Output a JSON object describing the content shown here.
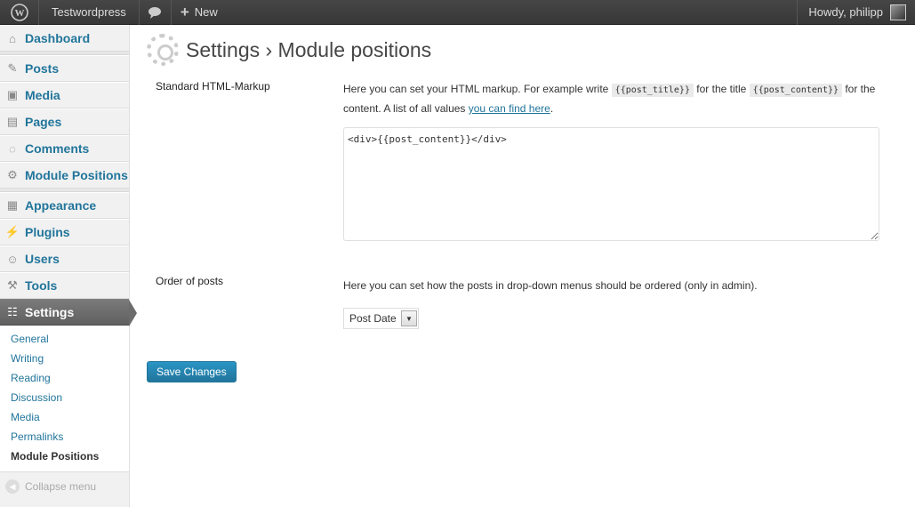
{
  "adminbar": {
    "site_name": "Testwordpress",
    "new_label": "New",
    "howdy": "Howdy, philipp",
    "icons": [
      "wordpress-logo-icon",
      "comment-icon",
      "plus-icon"
    ]
  },
  "sidebar": {
    "items": [
      {
        "label": "Dashboard",
        "icon": "home-icon"
      },
      {
        "label": "Posts",
        "icon": "pin-icon"
      },
      {
        "label": "Media",
        "icon": "media-icon"
      },
      {
        "label": "Pages",
        "icon": "pages-icon"
      },
      {
        "label": "Comments",
        "icon": "comment-icon"
      },
      {
        "label": "Module Positions",
        "icon": "gear-icon"
      },
      {
        "label": "Appearance",
        "icon": "appearance-icon"
      },
      {
        "label": "Plugins",
        "icon": "plugin-icon"
      },
      {
        "label": "Users",
        "icon": "users-icon"
      },
      {
        "label": "Tools",
        "icon": "tools-icon"
      },
      {
        "label": "Settings",
        "icon": "settings-icon"
      }
    ],
    "submenu": [
      "General",
      "Writing",
      "Reading",
      "Discussion",
      "Media",
      "Permalinks",
      "Module Positions"
    ],
    "collapse_label": "Collapse menu"
  },
  "page": {
    "title": "Settings › Module positions",
    "markup_label": "Standard HTML-Markup",
    "markup_desc_1": "Here you can set your HTML markup. For example write ",
    "code_title": "{{post_title}}",
    "markup_desc_2": " for the title ",
    "code_content": "{{post_content}}",
    "markup_desc_3": " for the content. A list of all values ",
    "markup_link": "you can find here",
    "markup_desc_4": ".",
    "markup_value": "<div>{{post_content}}</div>",
    "order_label": "Order of posts",
    "order_desc": "Here you can set how the posts in drop-down menus should be ordered (only in admin).",
    "order_selected": "Post Date",
    "save_label": "Save Changes"
  },
  "colors": {
    "link": "#21759b",
    "button": "#21759b",
    "adminbar": "#464646"
  }
}
